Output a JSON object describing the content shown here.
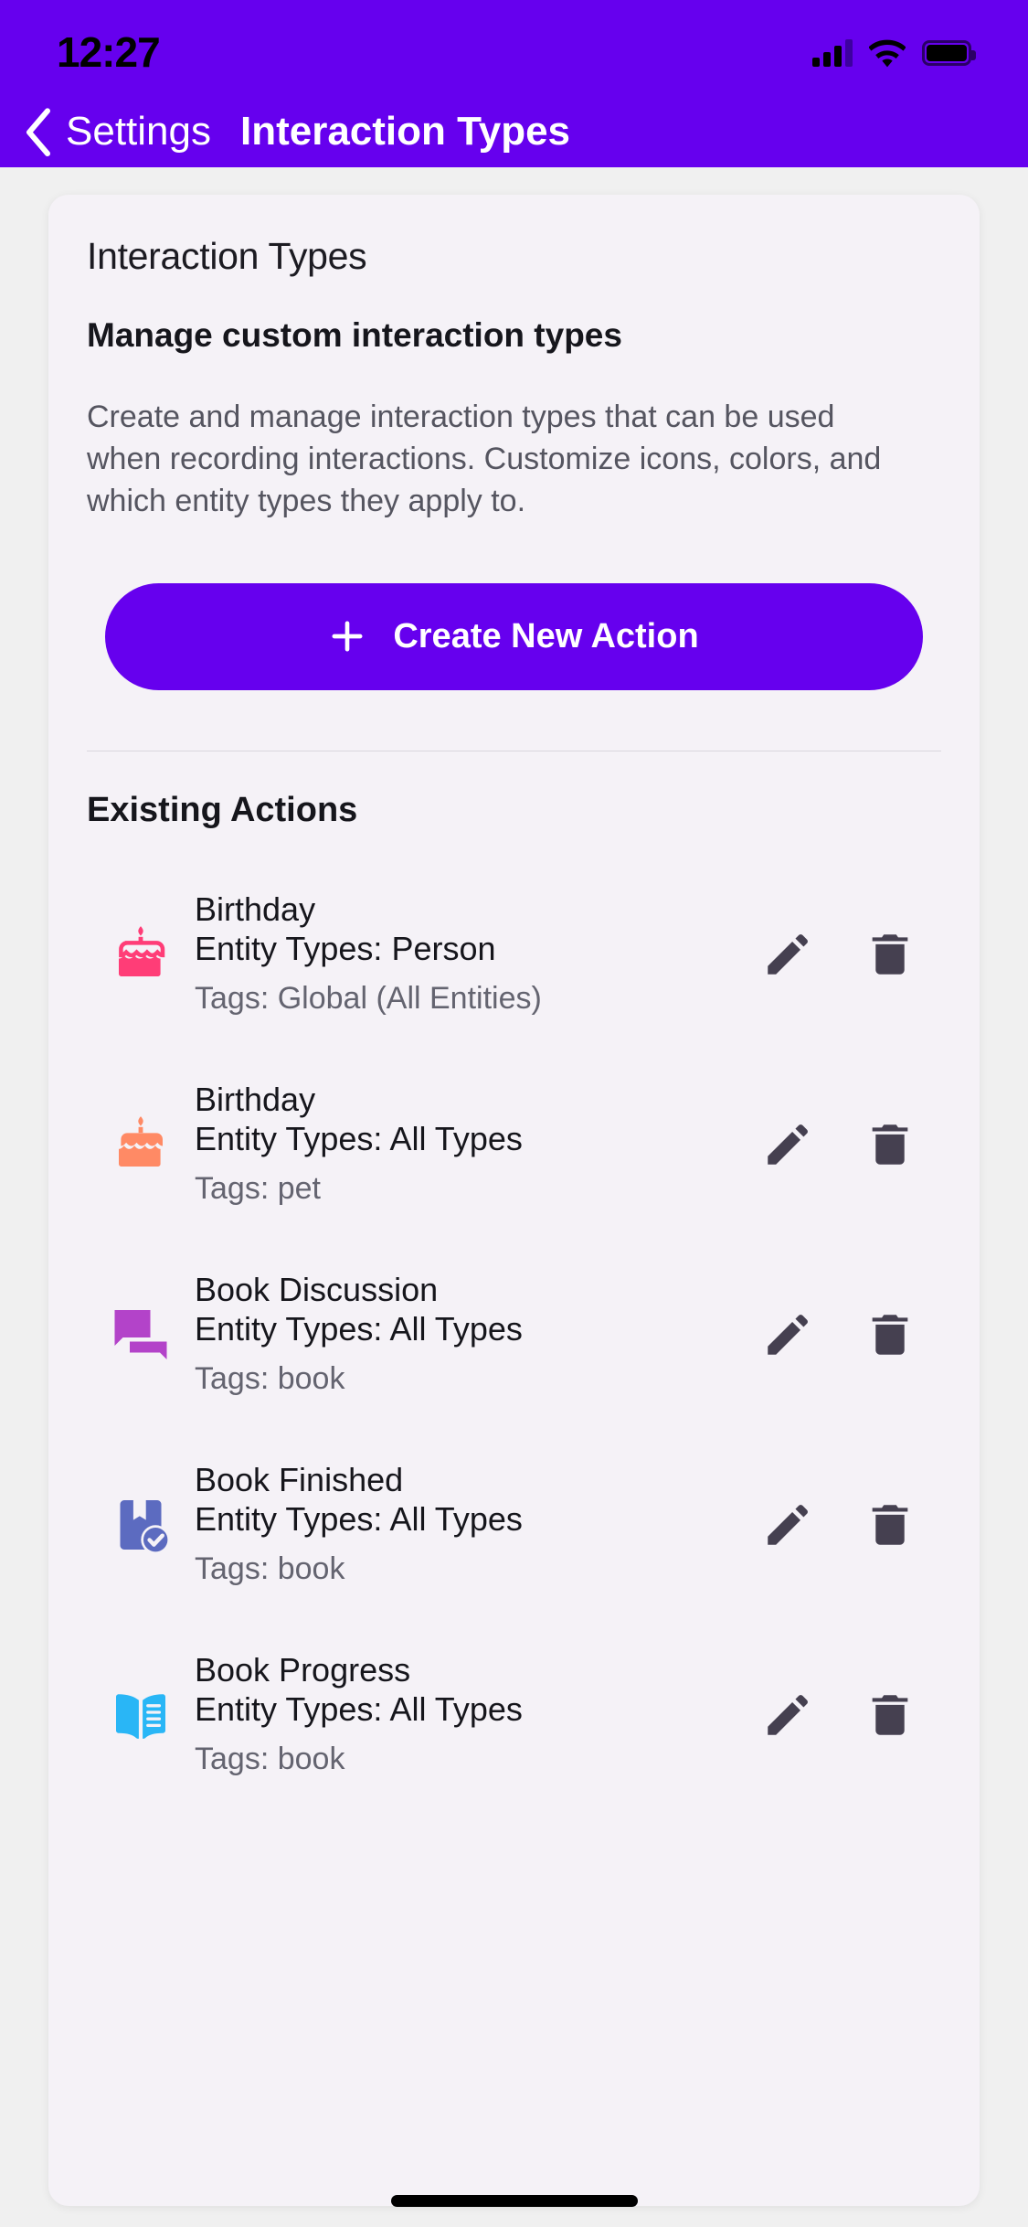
{
  "status_bar": {
    "time": "12:27",
    "signal_icon": "cellular-signal-icon",
    "wifi_icon": "wifi-icon",
    "battery_icon": "battery-full-icon"
  },
  "nav_bar": {
    "back_icon": "chevron-left-icon",
    "back_label": "Settings",
    "title": "Interaction Types"
  },
  "card": {
    "title": "Interaction Types",
    "subtitle": "Manage custom interaction types",
    "description": "Create and manage interaction types that can be used when recording interactions. Customize icons, colors, and which entity types they apply to.",
    "create_button": {
      "label": "Create New Action",
      "icon": "plus-icon",
      "color": "#6600EE"
    },
    "section_heading": "Existing Actions"
  },
  "actions": [
    {
      "name": "Birthday",
      "entity_types": "Entity Types: Person",
      "tags": "Tags: Global (All Entities)",
      "icon": "birthday-cake-icon",
      "icon_color": "#FF3D77",
      "edit_icon": "pencil-icon",
      "delete_icon": "trash-icon"
    },
    {
      "name": "Birthday",
      "entity_types": "Entity Types: All Types",
      "tags": "Tags: pet",
      "icon": "birthday-cake-icon",
      "icon_color": "#FF8A65",
      "edit_icon": "pencil-icon",
      "delete_icon": "trash-icon"
    },
    {
      "name": "Book Discussion",
      "entity_types": "Entity Types: All Types",
      "tags": "Tags: book",
      "icon": "chat-bubbles-icon",
      "icon_color": "#B343C9",
      "edit_icon": "pencil-icon",
      "delete_icon": "trash-icon"
    },
    {
      "name": "Book Finished",
      "entity_types": "Entity Types: All Types",
      "tags": "Tags: book",
      "icon": "bookmark-check-icon",
      "icon_color": "#5C6BC0",
      "edit_icon": "pencil-icon",
      "delete_icon": "trash-icon"
    },
    {
      "name": "Book Progress",
      "entity_types": "Entity Types: All Types",
      "tags": "Tags: book",
      "icon": "open-book-icon",
      "icon_color": "#29B6F6",
      "edit_icon": "pencil-icon",
      "delete_icon": "trash-icon"
    }
  ],
  "theme": {
    "accent": "#6600EE",
    "page_background": "#F0F0F0",
    "card_background": "#F5F2F7",
    "icon_button_color": "#454050"
  }
}
